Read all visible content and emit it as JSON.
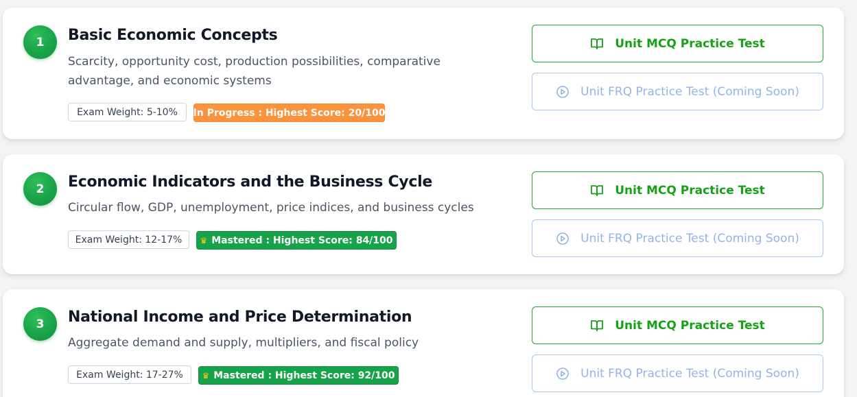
{
  "units": [
    {
      "number": "1",
      "title": "Basic Economic Concepts",
      "description": "Scarcity, opportunity cost, production possibilities, comparative advantage, and economic systems",
      "exam_weight": "Exam Weight: 5-10%",
      "status": "In Progress : Highest Score: 20/100",
      "status_type": "in-progress",
      "mcq_label": "Unit MCQ Practice Test",
      "frq_label": "Unit FRQ Practice Test (Coming Soon)"
    },
    {
      "number": "2",
      "title": "Economic Indicators and the Business Cycle",
      "description": "Circular flow, GDP, unemployment, price indices, and business cycles",
      "exam_weight": "Exam Weight: 12-17%",
      "status": "Mastered : Highest Score: 84/100",
      "status_type": "mastered",
      "mcq_label": "Unit MCQ Practice Test",
      "frq_label": "Unit FRQ Practice Test (Coming Soon)"
    },
    {
      "number": "3",
      "title": "National Income and Price Determination",
      "description": "Aggregate demand and supply, multipliers, and fiscal policy",
      "exam_weight": "Exam Weight: 17-27%",
      "status": "Mastered : Highest Score: 92/100",
      "status_type": "mastered",
      "mcq_label": "Unit MCQ Practice Test",
      "frq_label": "Unit FRQ Practice Test (Coming Soon)"
    }
  ],
  "icons": {
    "mcq": "book-open-icon",
    "frq": "play-circle-icon",
    "mastered": "crown-icon"
  },
  "colors": {
    "badge_green": "#1aa34a",
    "mcq_green": "#16a116",
    "frq_blue": "#93b4e6",
    "in_progress_orange": "#fb923c",
    "mastered_green": "#16a34a",
    "crown_yellow": "#facc15"
  }
}
